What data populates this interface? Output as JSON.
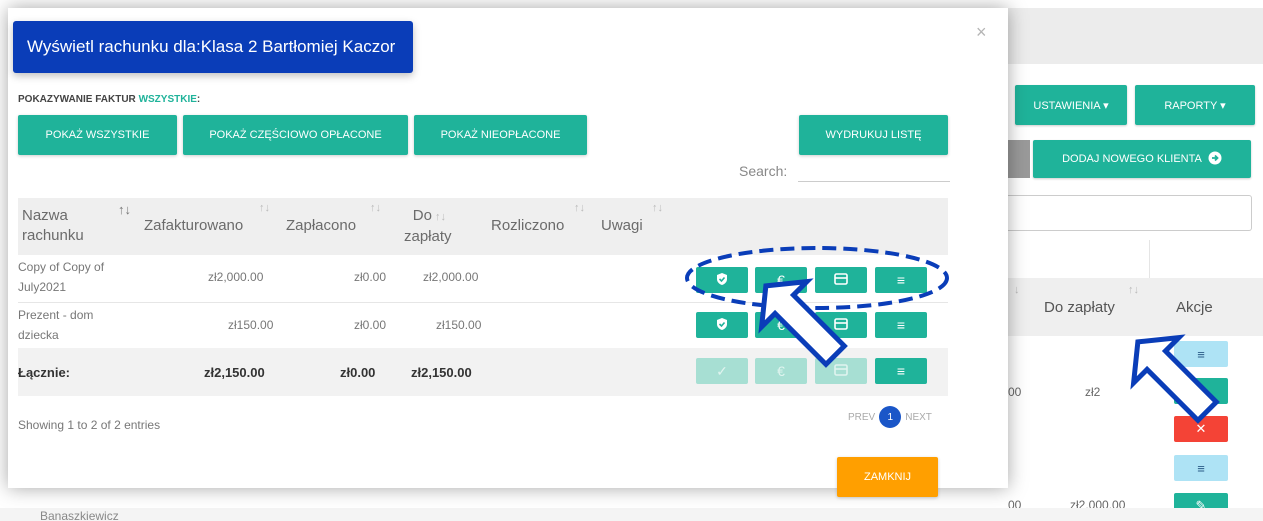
{
  "background": {
    "ustawienia_label": "USTAWIENIA ▾",
    "raporty_label": "RAPORTY ▾",
    "dodaj_label": "DODAJ NOWEGO KLIENTA",
    "col_do_zaplaty": "Do zapłaty",
    "col_akcje": "Akcje",
    "row1_value_partial": "00",
    "row1_amount_partial": "zł2",
    "row2_value_partial": "00",
    "row2_amount": "zł2,000.00",
    "bottom_name": "Banaszkiewicz"
  },
  "modal": {
    "title": "Wyświetl rachunku dla:Klasa 2 Bartłomiej Kaczor",
    "close_icon": "×",
    "filter_prefix": "POKAZYWANIE FAKTUR ",
    "filter_value": "WSZYSTKIE",
    "filter_suffix": ":",
    "buttons": {
      "show_all": "POKAŻ WSZYSTKIE",
      "show_partial": "POKAŻ CZĘŚCIOWO OPŁACONE",
      "show_unpaid": "POKAŻ NIEOPŁACONE",
      "print_list": "WYDRUKUJ LISTĘ"
    },
    "search_label": "Search:",
    "columns": {
      "name_l1": "Nazwa",
      "name_l2": "rachunku",
      "invoiced": "Zafakturowano",
      "paid": "Zapłacono",
      "due_l1": "Do",
      "due_l2": "zapłaty",
      "settled": "Rozliczono",
      "notes": "Uwagi"
    },
    "rows": [
      {
        "name_l1": "Copy of Copy of",
        "name_l2": "July2021",
        "invoiced": "zł2,000.00",
        "paid": "zł0.00",
        "due": "zł2,000.00"
      },
      {
        "name_l1": "Prezent - dom",
        "name_l2": "dziecka",
        "invoiced": "zł150.00",
        "paid": "zł0.00",
        "due": "zł150.00"
      }
    ],
    "totals": {
      "label": "Łącznie:",
      "invoiced": "zł2,150.00",
      "paid": "zł0.00",
      "due": "zł2,150.00"
    },
    "showing": "Showing 1 to 2 of 2 entries",
    "pager": {
      "prev": "PREV",
      "page": "1",
      "next": "NEXT"
    },
    "close_button": "ZAMKNIJ"
  },
  "icons": {
    "settle": "shield-check-icon",
    "pay": "euro-icon",
    "card": "card-icon",
    "list": "list-icon",
    "edit": "pencil-icon",
    "delete": "close-icon"
  },
  "colors": {
    "accent": "#1fb39a",
    "title_bg": "#0a3db8",
    "close_button": "#ff9f00",
    "delete": "#f44336",
    "annotation": "#0a3db8"
  }
}
